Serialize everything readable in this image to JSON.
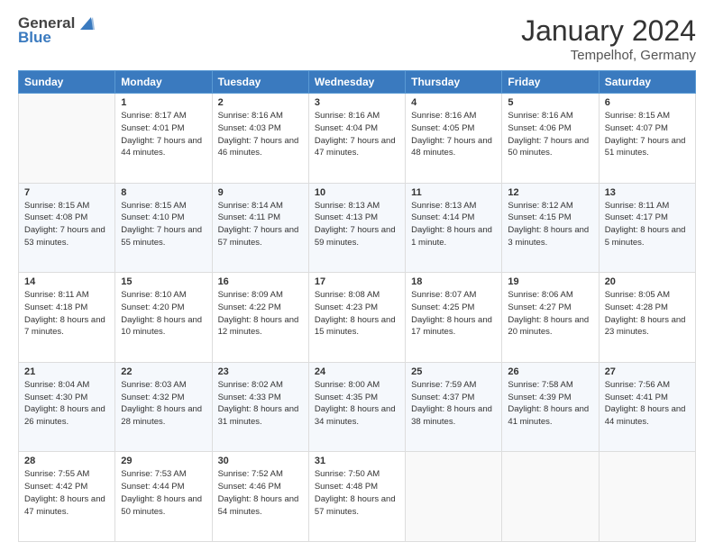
{
  "logo": {
    "general": "General",
    "blue": "Blue"
  },
  "title": "January 2024",
  "location": "Tempelhof, Germany",
  "days_of_week": [
    "Sunday",
    "Monday",
    "Tuesday",
    "Wednesday",
    "Thursday",
    "Friday",
    "Saturday"
  ],
  "weeks": [
    [
      {
        "day": "",
        "sunrise": "",
        "sunset": "",
        "daylight": ""
      },
      {
        "day": "1",
        "sunrise": "Sunrise: 8:17 AM",
        "sunset": "Sunset: 4:01 PM",
        "daylight": "Daylight: 7 hours and 44 minutes."
      },
      {
        "day": "2",
        "sunrise": "Sunrise: 8:16 AM",
        "sunset": "Sunset: 4:03 PM",
        "daylight": "Daylight: 7 hours and 46 minutes."
      },
      {
        "day": "3",
        "sunrise": "Sunrise: 8:16 AM",
        "sunset": "Sunset: 4:04 PM",
        "daylight": "Daylight: 7 hours and 47 minutes."
      },
      {
        "day": "4",
        "sunrise": "Sunrise: 8:16 AM",
        "sunset": "Sunset: 4:05 PM",
        "daylight": "Daylight: 7 hours and 48 minutes."
      },
      {
        "day": "5",
        "sunrise": "Sunrise: 8:16 AM",
        "sunset": "Sunset: 4:06 PM",
        "daylight": "Daylight: 7 hours and 50 minutes."
      },
      {
        "day": "6",
        "sunrise": "Sunrise: 8:15 AM",
        "sunset": "Sunset: 4:07 PM",
        "daylight": "Daylight: 7 hours and 51 minutes."
      }
    ],
    [
      {
        "day": "7",
        "sunrise": "Sunrise: 8:15 AM",
        "sunset": "Sunset: 4:08 PM",
        "daylight": "Daylight: 7 hours and 53 minutes."
      },
      {
        "day": "8",
        "sunrise": "Sunrise: 8:15 AM",
        "sunset": "Sunset: 4:10 PM",
        "daylight": "Daylight: 7 hours and 55 minutes."
      },
      {
        "day": "9",
        "sunrise": "Sunrise: 8:14 AM",
        "sunset": "Sunset: 4:11 PM",
        "daylight": "Daylight: 7 hours and 57 minutes."
      },
      {
        "day": "10",
        "sunrise": "Sunrise: 8:13 AM",
        "sunset": "Sunset: 4:13 PM",
        "daylight": "Daylight: 7 hours and 59 minutes."
      },
      {
        "day": "11",
        "sunrise": "Sunrise: 8:13 AM",
        "sunset": "Sunset: 4:14 PM",
        "daylight": "Daylight: 8 hours and 1 minute."
      },
      {
        "day": "12",
        "sunrise": "Sunrise: 8:12 AM",
        "sunset": "Sunset: 4:15 PM",
        "daylight": "Daylight: 8 hours and 3 minutes."
      },
      {
        "day": "13",
        "sunrise": "Sunrise: 8:11 AM",
        "sunset": "Sunset: 4:17 PM",
        "daylight": "Daylight: 8 hours and 5 minutes."
      }
    ],
    [
      {
        "day": "14",
        "sunrise": "Sunrise: 8:11 AM",
        "sunset": "Sunset: 4:18 PM",
        "daylight": "Daylight: 8 hours and 7 minutes."
      },
      {
        "day": "15",
        "sunrise": "Sunrise: 8:10 AM",
        "sunset": "Sunset: 4:20 PM",
        "daylight": "Daylight: 8 hours and 10 minutes."
      },
      {
        "day": "16",
        "sunrise": "Sunrise: 8:09 AM",
        "sunset": "Sunset: 4:22 PM",
        "daylight": "Daylight: 8 hours and 12 minutes."
      },
      {
        "day": "17",
        "sunrise": "Sunrise: 8:08 AM",
        "sunset": "Sunset: 4:23 PM",
        "daylight": "Daylight: 8 hours and 15 minutes."
      },
      {
        "day": "18",
        "sunrise": "Sunrise: 8:07 AM",
        "sunset": "Sunset: 4:25 PM",
        "daylight": "Daylight: 8 hours and 17 minutes."
      },
      {
        "day": "19",
        "sunrise": "Sunrise: 8:06 AM",
        "sunset": "Sunset: 4:27 PM",
        "daylight": "Daylight: 8 hours and 20 minutes."
      },
      {
        "day": "20",
        "sunrise": "Sunrise: 8:05 AM",
        "sunset": "Sunset: 4:28 PM",
        "daylight": "Daylight: 8 hours and 23 minutes."
      }
    ],
    [
      {
        "day": "21",
        "sunrise": "Sunrise: 8:04 AM",
        "sunset": "Sunset: 4:30 PM",
        "daylight": "Daylight: 8 hours and 26 minutes."
      },
      {
        "day": "22",
        "sunrise": "Sunrise: 8:03 AM",
        "sunset": "Sunset: 4:32 PM",
        "daylight": "Daylight: 8 hours and 28 minutes."
      },
      {
        "day": "23",
        "sunrise": "Sunrise: 8:02 AM",
        "sunset": "Sunset: 4:33 PM",
        "daylight": "Daylight: 8 hours and 31 minutes."
      },
      {
        "day": "24",
        "sunrise": "Sunrise: 8:00 AM",
        "sunset": "Sunset: 4:35 PM",
        "daylight": "Daylight: 8 hours and 34 minutes."
      },
      {
        "day": "25",
        "sunrise": "Sunrise: 7:59 AM",
        "sunset": "Sunset: 4:37 PM",
        "daylight": "Daylight: 8 hours and 38 minutes."
      },
      {
        "day": "26",
        "sunrise": "Sunrise: 7:58 AM",
        "sunset": "Sunset: 4:39 PM",
        "daylight": "Daylight: 8 hours and 41 minutes."
      },
      {
        "day": "27",
        "sunrise": "Sunrise: 7:56 AM",
        "sunset": "Sunset: 4:41 PM",
        "daylight": "Daylight: 8 hours and 44 minutes."
      }
    ],
    [
      {
        "day": "28",
        "sunrise": "Sunrise: 7:55 AM",
        "sunset": "Sunset: 4:42 PM",
        "daylight": "Daylight: 8 hours and 47 minutes."
      },
      {
        "day": "29",
        "sunrise": "Sunrise: 7:53 AM",
        "sunset": "Sunset: 4:44 PM",
        "daylight": "Daylight: 8 hours and 50 minutes."
      },
      {
        "day": "30",
        "sunrise": "Sunrise: 7:52 AM",
        "sunset": "Sunset: 4:46 PM",
        "daylight": "Daylight: 8 hours and 54 minutes."
      },
      {
        "day": "31",
        "sunrise": "Sunrise: 7:50 AM",
        "sunset": "Sunset: 4:48 PM",
        "daylight": "Daylight: 8 hours and 57 minutes."
      },
      {
        "day": "",
        "sunrise": "",
        "sunset": "",
        "daylight": ""
      },
      {
        "day": "",
        "sunrise": "",
        "sunset": "",
        "daylight": ""
      },
      {
        "day": "",
        "sunrise": "",
        "sunset": "",
        "daylight": ""
      }
    ]
  ]
}
